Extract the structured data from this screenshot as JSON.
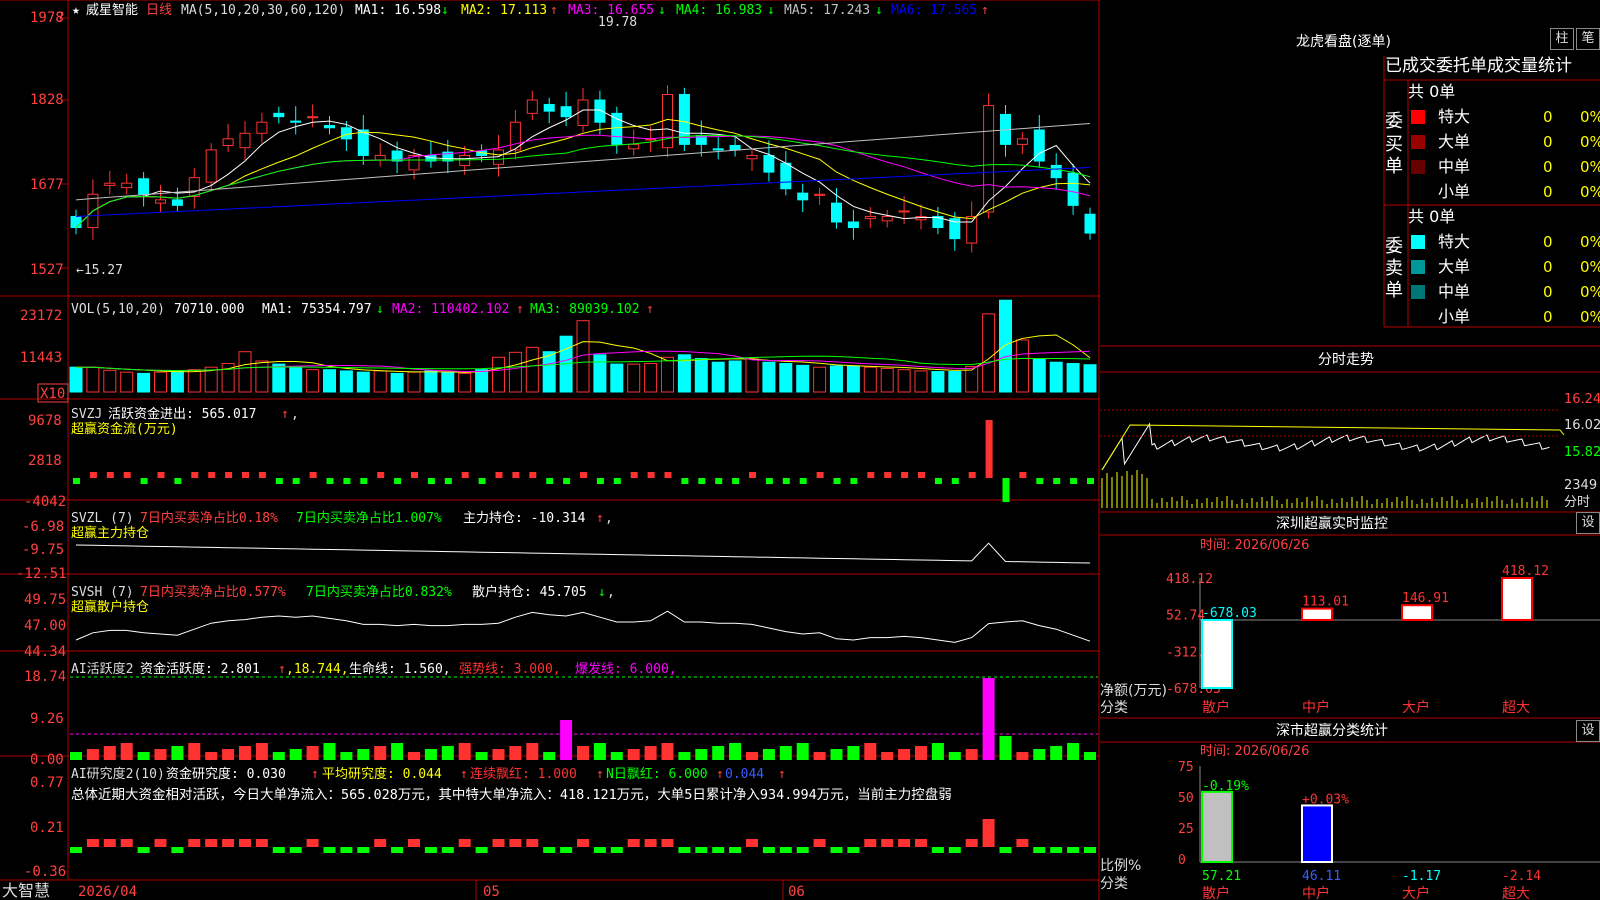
{
  "colors": {
    "up": "#ff3232",
    "down": "#00ffff",
    "ma1": "#ffffff",
    "ma2": "#ffff00",
    "ma3": "#ff00ff",
    "ma4": "#00ff00",
    "ma5": "#c0c0c0",
    "ma6": "#0000ff",
    "grid": "#b00000",
    "label": "#ff4040",
    "green": "#00ff00",
    "yellow": "#ffff00",
    "magenta": "#ff00ff"
  },
  "header": {
    "star": "★",
    "stock": "威星智能",
    "period": "日线",
    "ma_name": "MA(5,10,20,30,60,120)",
    "ma": [
      {
        "label": "MA1: 16.598",
        "arrow": "↓"
      },
      {
        "label": "MA2: 17.113",
        "arrow": "↑"
      },
      {
        "label": "MA3: 16.655",
        "arrow": "↓"
      },
      {
        "label": "MA4: 16.983",
        "arrow": "↓"
      },
      {
        "label": "MA5: 17.243",
        "arrow": "↓"
      },
      {
        "label": "MA6: 17.565",
        "arrow": "↑"
      }
    ]
  },
  "price_axis": {
    "labels": [
      "1978",
      "1828",
      "1677",
      "1527"
    ],
    "high_marker": "19.78",
    "low_marker": "←15.27",
    "corner": "?"
  },
  "vol_panel": {
    "title": "VOL(5,10,20)",
    "value": "70710.000",
    "ma1": "MA1: 75354.797",
    "ma1_arrow": "↓",
    "ma2": "MA2: 110402.102",
    "ma2_arrow": "↑",
    "ma3": "MA3: 89039.102",
    "ma3_arrow": "↑",
    "axis": [
      "23172",
      "11443"
    ],
    "unit": "X10"
  },
  "svzj": {
    "title": "SVZJ",
    "line1": " 活跃资金进出: 565.017",
    "arrow": "↑",
    "comma": ",",
    "sub": "超赢资金流(万元)",
    "axis": [
      "9678",
      "2818",
      "-4042"
    ]
  },
  "svzl": {
    "title": "SVZL (7)",
    "p1": "7日内买卖净占比0.18%",
    "p2": "7日内买卖净占比1.007%",
    "p3": "主力持仓: -10.314",
    "arrow": "↑",
    "comma": ",",
    "sub": "超赢主力持仓",
    "axis": [
      "-6.98",
      "-9.75",
      "-12.51"
    ]
  },
  "svsh": {
    "title": "SVSH (7)",
    "p1": "7日内买卖净占比0.577%",
    "p2": "7日内买卖净占比0.832%",
    "p3": "散户持仓: 45.705",
    "arrow": "↓",
    "comma": ",",
    "sub": "超赢散户持仓",
    "axis": [
      "49.75",
      "47.00",
      "44.34"
    ]
  },
  "ai_act": {
    "title": "AI活跃度2",
    "p1": " 资金活跃度: 2.801",
    "a1": "↑",
    "p2": ",18.744,",
    "p3": " 生命线: 1.560,",
    "p4": " 强势线: 3.000,",
    "p5": " 爆发线: 6.000,",
    "axis": [
      "18.74",
      "9.26",
      "0.00"
    ]
  },
  "ai_res": {
    "title": "AI研究度2(10)",
    "p1": " 资金研究度: 0.030",
    "a1": "↑",
    "p2": " 平均研究度: 0.044",
    "a2": "↑",
    "p3": " 连续飘红: 1.000",
    "a3": "↑",
    "p4": " N日飘红: 6.000",
    "a4": "↑",
    "p5": " 0.044",
    "a5": "↑",
    "summary": "总体近期大资金相对活跃，今日大单净流入：565.028万元，其中特大单净流入：418.121万元，大单5日累计净入934.994万元，当前主力控盘弱",
    "axis": [
      "0.77",
      "0.21",
      "-0.36"
    ]
  },
  "date_axis": {
    "brand": "大智慧",
    "d0": "2026/04",
    "d1": "05",
    "d2": "06"
  },
  "lhb": {
    "title": "龙虎看盘(逐单)",
    "btn1": "柱",
    "btn2": "笔",
    "tabs": "已成交委托单成交量统计",
    "buy_label": "委买单",
    "sell_label": "委卖单",
    "buy_total": "共 0单",
    "sell_total": "共 0单",
    "rows_buy": [
      {
        "name": "特大",
        "v": "0",
        "p": "0%",
        "c": "#ff0000"
      },
      {
        "name": "大单",
        "v": "0",
        "p": "0%",
        "c": "#990000"
      },
      {
        "name": "中单",
        "v": "0",
        "p": "0%",
        "c": "#660000"
      },
      {
        "name": "小单",
        "v": "0",
        "p": "0%",
        "c": ""
      }
    ],
    "rows_sell": [
      {
        "name": "特大",
        "v": "0",
        "p": "0%",
        "c": "#00ffff"
      },
      {
        "name": "大单",
        "v": "0",
        "p": "0%",
        "c": "#009999"
      },
      {
        "name": "中单",
        "v": "0",
        "p": "0%",
        "c": "#007777"
      },
      {
        "name": "小单",
        "v": "0",
        "p": "0%",
        "c": ""
      }
    ]
  },
  "intraday": {
    "title": "分时走势",
    "axis": [
      "16.24",
      "16.02",
      "15.82"
    ],
    "vol": "2349",
    "vol_unit": "分时"
  },
  "sz_monitor": {
    "title": "深圳超赢实时监控",
    "btn": "设",
    "time": "时间: 2026/06/26",
    "axis": [
      "418.12",
      "52.74",
      "-312.65",
      "-678.03"
    ],
    "ylabel": "净额(万元)",
    "xlabel": "分类"
  },
  "sz_class": {
    "title": "深市超赢分类统计",
    "btn": "设",
    "time": "时间: 2026/06/26",
    "axis": [
      "75",
      "50",
      "25",
      "0"
    ],
    "ylabel": "比例%",
    "xlabel": "分类"
  },
  "chart_data": [
    {
      "type": "bar",
      "title": "深圳超赢实时监控",
      "categories": [
        "散户",
        "中户",
        "大户",
        "超大"
      ],
      "values": [
        -678.03,
        113.01,
        146.91,
        418.12
      ],
      "ylim": [
        -678.03,
        418.12
      ],
      "ylabel": "净额(万元)",
      "xlabel": "分类"
    },
    {
      "type": "bar",
      "title": "深市超赢分类统计",
      "categories": [
        "散户",
        "中户",
        "大户",
        "超大"
      ],
      "top_labels": [
        "-0.19%",
        "+0.03%",
        "",
        ""
      ],
      "values": [
        57.21,
        46.11,
        -1.17,
        -2.14
      ],
      "ylim": [
        0,
        75
      ],
      "ylabel": "比例%",
      "xlabel": "分类"
    }
  ]
}
